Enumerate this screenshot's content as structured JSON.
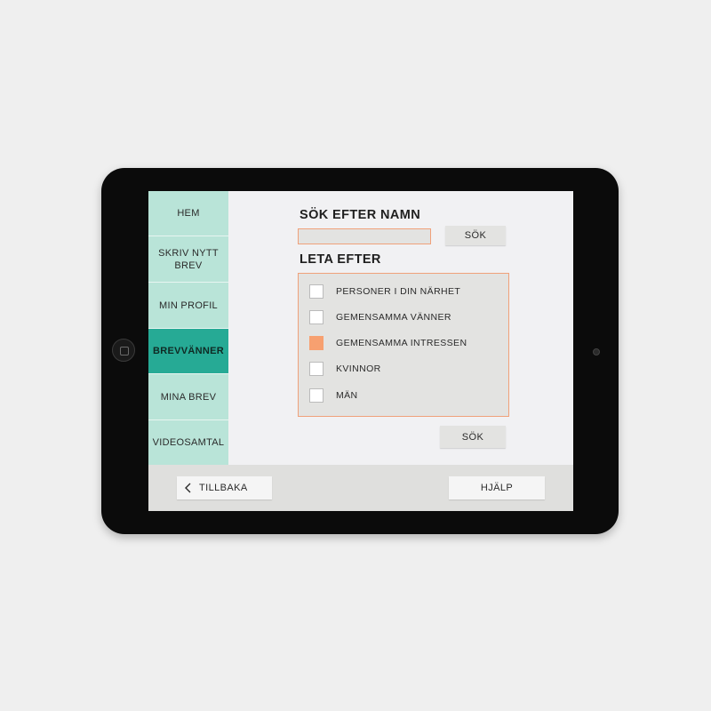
{
  "sidebar": {
    "items": [
      {
        "label": "HEM"
      },
      {
        "label": "SKRIV NYTT\nBREV"
      },
      {
        "label": "MIN PROFIL"
      },
      {
        "label": "BREVVÄNNER",
        "active": true
      },
      {
        "label": "MINA BREV"
      },
      {
        "label": "VIDEOSAMTAL"
      }
    ]
  },
  "search": {
    "heading": "SÖK EFTER NAMN",
    "input_value": "",
    "button_label": "SÖK"
  },
  "filter": {
    "heading": "LETA EFTER",
    "options": [
      {
        "label": "PERSONER I DIN NÄRHET",
        "checked": false
      },
      {
        "label": "GEMENSAMMA VÄNNER",
        "checked": false
      },
      {
        "label": "GEMENSAMMA INTRESSEN",
        "checked": true
      },
      {
        "label": "KVINNOR",
        "checked": false
      },
      {
        "label": "MÄN",
        "checked": false
      }
    ],
    "button_label": "SÖK"
  },
  "footer": {
    "back_label": "TILLBAKA",
    "back_icon": "chevron-left-icon",
    "help_label": "HJÄLP"
  },
  "colors": {
    "sidebar": "#b9e4d8",
    "active": "#26aa95",
    "accent": "#f7a070"
  }
}
